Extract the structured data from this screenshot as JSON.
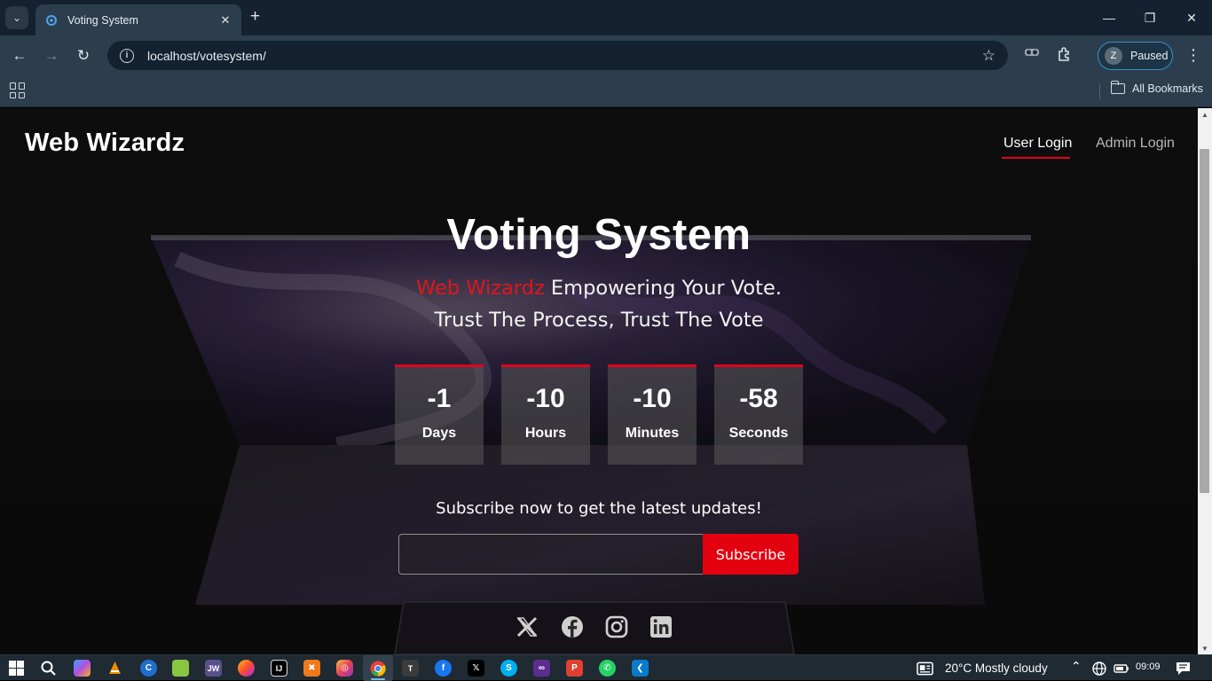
{
  "browser": {
    "tab_title": "Voting System",
    "url": "localhost/votesystem/",
    "profile_initial": "Z",
    "profile_status": "Paused",
    "bookmarks_label": "All Bookmarks"
  },
  "site": {
    "brand": "Web Wizardz",
    "nav": [
      {
        "label": "User Login",
        "active": true
      },
      {
        "label": "Admin Login",
        "active": false
      }
    ]
  },
  "hero": {
    "title": "Voting System",
    "tagline_accent": "Web Wizardz",
    "tagline_rest": " Empowering Your Vote.",
    "tagline_line2": "Trust The Process, Trust The Vote"
  },
  "countdown": [
    {
      "value": "-1",
      "label": "Days"
    },
    {
      "value": "-10",
      "label": "Hours"
    },
    {
      "value": "-10",
      "label": "Minutes"
    },
    {
      "value": "-58",
      "label": "Seconds"
    }
  ],
  "subscribe": {
    "text": "Subscribe now to get the latest updates!",
    "input_value": "",
    "button_label": "Subscribe"
  },
  "social_icons": [
    "x-icon",
    "facebook-icon",
    "instagram-icon",
    "linkedin-icon"
  ],
  "taskbar": {
    "weather": "20°C  Mostly cloudy",
    "time": "09:09"
  },
  "colors": {
    "accent_red": "#e3001b",
    "browser_dark": "#142130",
    "browser_toolbar": "#2c3e4e"
  }
}
